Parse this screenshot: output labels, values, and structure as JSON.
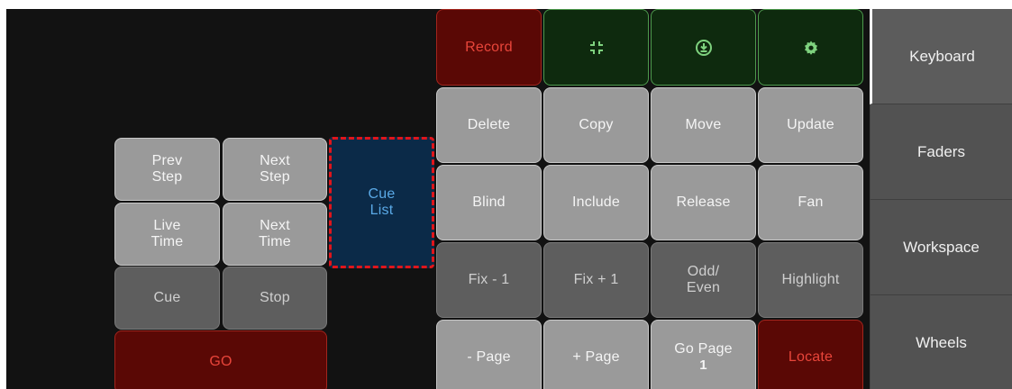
{
  "left_panel": {
    "prev_step": "Prev\nStep",
    "next_step": "Next\nStep",
    "live_time": "Live\nTime",
    "next_time": "Next\nTime",
    "cue": "Cue",
    "stop": "Stop",
    "go": "GO",
    "cue_list": "Cue\nList"
  },
  "top_row": {
    "record": "Record",
    "collapse_icon": "collapse-icon",
    "download_icon": "download-icon",
    "gear_icon": "gear-icon"
  },
  "keys": {
    "delete": "Delete",
    "copy": "Copy",
    "move": "Move",
    "update": "Update",
    "blind": "Blind",
    "include": "Include",
    "release": "Release",
    "fan": "Fan",
    "fix_minus": "Fix - 1",
    "fix_plus": "Fix + 1",
    "odd_even": "Odd/\nEven",
    "highlight": "Highlight",
    "page_minus": "- Page",
    "page_plus": "+ Page",
    "go_page": "Go Page",
    "go_page_num": "1",
    "locate": "Locate"
  },
  "sidebar": {
    "tabs": [
      {
        "label": "Keyboard",
        "active": true
      },
      {
        "label": "Faders",
        "active": false
      },
      {
        "label": "Workspace",
        "active": false
      },
      {
        "label": "Wheels",
        "active": false
      }
    ]
  },
  "colors": {
    "background": "#121212",
    "record_red": "#e8453a",
    "icon_green": "#7ed27e",
    "cue_list_blue": "#5aa9e6",
    "selection_dash": "#e0151b"
  }
}
